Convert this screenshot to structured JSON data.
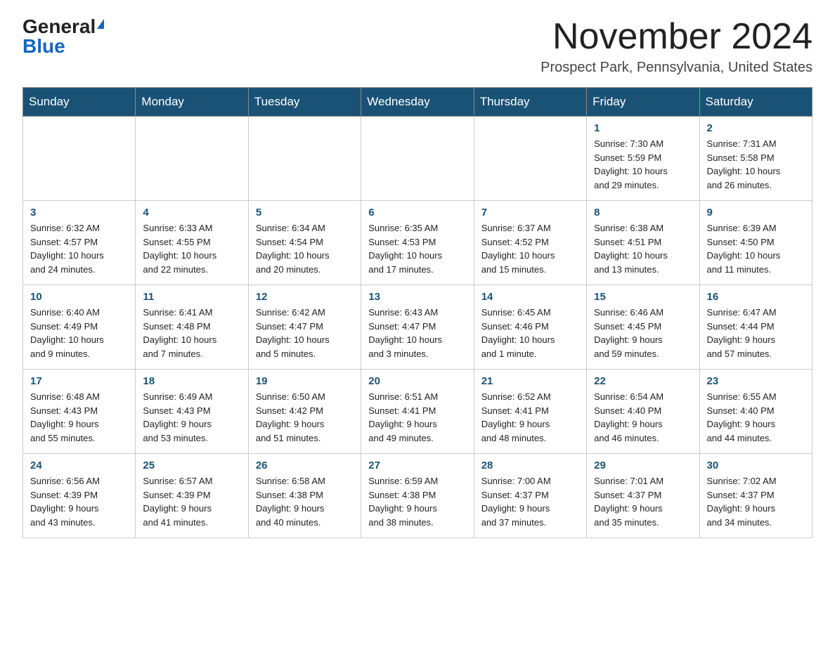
{
  "logo": {
    "general": "General",
    "blue": "Blue"
  },
  "title": "November 2024",
  "location": "Prospect Park, Pennsylvania, United States",
  "weekdays": [
    "Sunday",
    "Monday",
    "Tuesday",
    "Wednesday",
    "Thursday",
    "Friday",
    "Saturday"
  ],
  "weeks": [
    [
      {
        "day": "",
        "info": ""
      },
      {
        "day": "",
        "info": ""
      },
      {
        "day": "",
        "info": ""
      },
      {
        "day": "",
        "info": ""
      },
      {
        "day": "",
        "info": ""
      },
      {
        "day": "1",
        "info": "Sunrise: 7:30 AM\nSunset: 5:59 PM\nDaylight: 10 hours\nand 29 minutes."
      },
      {
        "day": "2",
        "info": "Sunrise: 7:31 AM\nSunset: 5:58 PM\nDaylight: 10 hours\nand 26 minutes."
      }
    ],
    [
      {
        "day": "3",
        "info": "Sunrise: 6:32 AM\nSunset: 4:57 PM\nDaylight: 10 hours\nand 24 minutes."
      },
      {
        "day": "4",
        "info": "Sunrise: 6:33 AM\nSunset: 4:55 PM\nDaylight: 10 hours\nand 22 minutes."
      },
      {
        "day": "5",
        "info": "Sunrise: 6:34 AM\nSunset: 4:54 PM\nDaylight: 10 hours\nand 20 minutes."
      },
      {
        "day": "6",
        "info": "Sunrise: 6:35 AM\nSunset: 4:53 PM\nDaylight: 10 hours\nand 17 minutes."
      },
      {
        "day": "7",
        "info": "Sunrise: 6:37 AM\nSunset: 4:52 PM\nDaylight: 10 hours\nand 15 minutes."
      },
      {
        "day": "8",
        "info": "Sunrise: 6:38 AM\nSunset: 4:51 PM\nDaylight: 10 hours\nand 13 minutes."
      },
      {
        "day": "9",
        "info": "Sunrise: 6:39 AM\nSunset: 4:50 PM\nDaylight: 10 hours\nand 11 minutes."
      }
    ],
    [
      {
        "day": "10",
        "info": "Sunrise: 6:40 AM\nSunset: 4:49 PM\nDaylight: 10 hours\nand 9 minutes."
      },
      {
        "day": "11",
        "info": "Sunrise: 6:41 AM\nSunset: 4:48 PM\nDaylight: 10 hours\nand 7 minutes."
      },
      {
        "day": "12",
        "info": "Sunrise: 6:42 AM\nSunset: 4:47 PM\nDaylight: 10 hours\nand 5 minutes."
      },
      {
        "day": "13",
        "info": "Sunrise: 6:43 AM\nSunset: 4:47 PM\nDaylight: 10 hours\nand 3 minutes."
      },
      {
        "day": "14",
        "info": "Sunrise: 6:45 AM\nSunset: 4:46 PM\nDaylight: 10 hours\nand 1 minute."
      },
      {
        "day": "15",
        "info": "Sunrise: 6:46 AM\nSunset: 4:45 PM\nDaylight: 9 hours\nand 59 minutes."
      },
      {
        "day": "16",
        "info": "Sunrise: 6:47 AM\nSunset: 4:44 PM\nDaylight: 9 hours\nand 57 minutes."
      }
    ],
    [
      {
        "day": "17",
        "info": "Sunrise: 6:48 AM\nSunset: 4:43 PM\nDaylight: 9 hours\nand 55 minutes."
      },
      {
        "day": "18",
        "info": "Sunrise: 6:49 AM\nSunset: 4:43 PM\nDaylight: 9 hours\nand 53 minutes."
      },
      {
        "day": "19",
        "info": "Sunrise: 6:50 AM\nSunset: 4:42 PM\nDaylight: 9 hours\nand 51 minutes."
      },
      {
        "day": "20",
        "info": "Sunrise: 6:51 AM\nSunset: 4:41 PM\nDaylight: 9 hours\nand 49 minutes."
      },
      {
        "day": "21",
        "info": "Sunrise: 6:52 AM\nSunset: 4:41 PM\nDaylight: 9 hours\nand 48 minutes."
      },
      {
        "day": "22",
        "info": "Sunrise: 6:54 AM\nSunset: 4:40 PM\nDaylight: 9 hours\nand 46 minutes."
      },
      {
        "day": "23",
        "info": "Sunrise: 6:55 AM\nSunset: 4:40 PM\nDaylight: 9 hours\nand 44 minutes."
      }
    ],
    [
      {
        "day": "24",
        "info": "Sunrise: 6:56 AM\nSunset: 4:39 PM\nDaylight: 9 hours\nand 43 minutes."
      },
      {
        "day": "25",
        "info": "Sunrise: 6:57 AM\nSunset: 4:39 PM\nDaylight: 9 hours\nand 41 minutes."
      },
      {
        "day": "26",
        "info": "Sunrise: 6:58 AM\nSunset: 4:38 PM\nDaylight: 9 hours\nand 40 minutes."
      },
      {
        "day": "27",
        "info": "Sunrise: 6:59 AM\nSunset: 4:38 PM\nDaylight: 9 hours\nand 38 minutes."
      },
      {
        "day": "28",
        "info": "Sunrise: 7:00 AM\nSunset: 4:37 PM\nDaylight: 9 hours\nand 37 minutes."
      },
      {
        "day": "29",
        "info": "Sunrise: 7:01 AM\nSunset: 4:37 PM\nDaylight: 9 hours\nand 35 minutes."
      },
      {
        "day": "30",
        "info": "Sunrise: 7:02 AM\nSunset: 4:37 PM\nDaylight: 9 hours\nand 34 minutes."
      }
    ]
  ]
}
